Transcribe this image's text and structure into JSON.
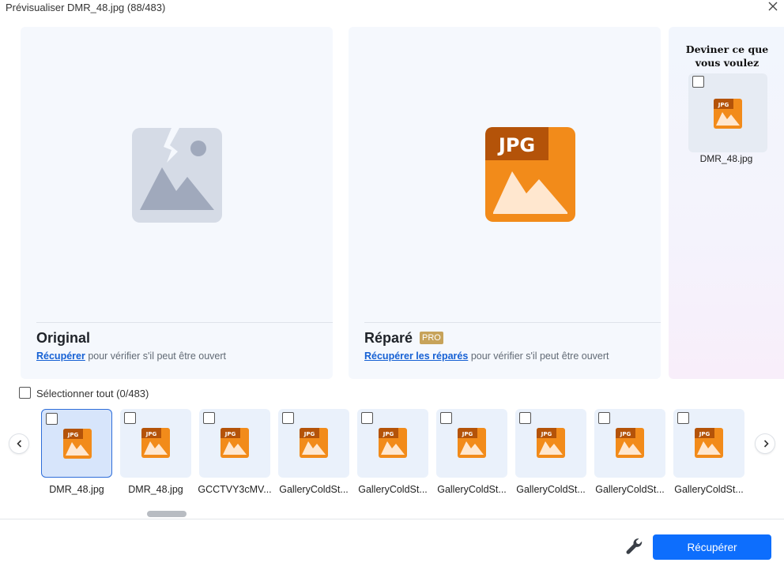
{
  "window": {
    "title": "Prévisualiser DMR_48.jpg (88/483)"
  },
  "original": {
    "label": "Original",
    "link_text": "Récupérer",
    "desc_text": " pour vérifier s'il peut être ouvert"
  },
  "repaired": {
    "label": "Réparé",
    "badge": "PRO",
    "link_text": "Récupérer les réparés",
    "desc_text": " pour vérifier s'il peut être ouvert"
  },
  "guess": {
    "title": "Deviner ce que vous voulez",
    "file_name": "DMR_48.jpg"
  },
  "icons": {
    "jpg_badge": "JPG"
  },
  "selection": {
    "label": "Sélectionner tout (0/483)"
  },
  "thumbnails": [
    {
      "name": "DMR_48.jpg",
      "selected": true
    },
    {
      "name": "DMR_48.jpg",
      "selected": false
    },
    {
      "name": "GCCTVY3cMV...",
      "selected": false
    },
    {
      "name": "GalleryColdSt...",
      "selected": false
    },
    {
      "name": "GalleryColdSt...",
      "selected": false
    },
    {
      "name": "GalleryColdSt...",
      "selected": false
    },
    {
      "name": "GalleryColdSt...",
      "selected": false
    },
    {
      "name": "GalleryColdSt...",
      "selected": false
    },
    {
      "name": "GalleryColdSt...",
      "selected": false
    }
  ],
  "footer": {
    "recover_label": "Récupérer"
  },
  "colors": {
    "accent": "#0d6efd",
    "jpg_orange": "#f28b1a",
    "jpg_dark": "#b45309",
    "pro_gold": "#c7a35a",
    "link": "#1560d4"
  }
}
